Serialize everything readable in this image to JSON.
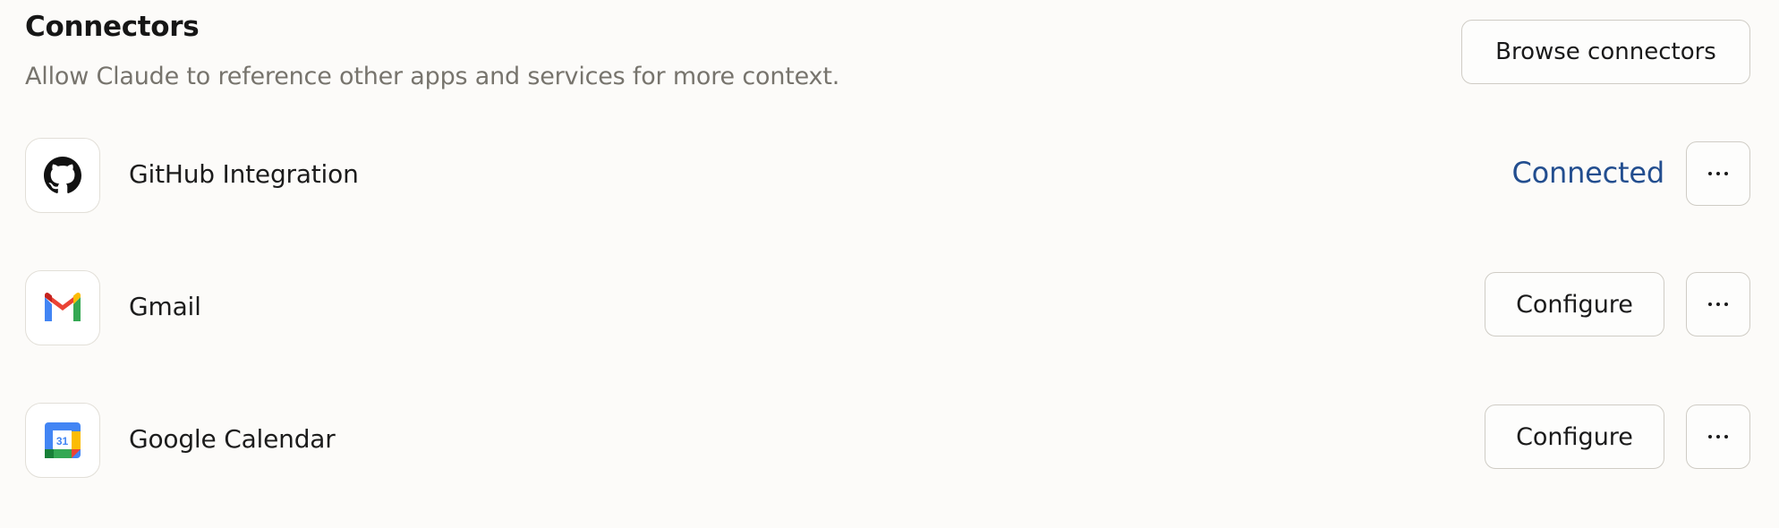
{
  "header": {
    "title": "Connectors",
    "subtitle": "Allow Claude to reference other apps and services for more context.",
    "browse_label": "Browse connectors"
  },
  "connectors": [
    {
      "name": "GitHub Integration",
      "icon": "github-icon",
      "status": "Connected",
      "more_icon": "more-horizontal-icon"
    },
    {
      "name": "Gmail",
      "icon": "gmail-icon",
      "action_label": "Configure",
      "more_icon": "more-horizontal-icon"
    },
    {
      "name": "Google Calendar",
      "icon": "google-calendar-icon",
      "icon_text": "31",
      "action_label": "Configure",
      "more_icon": "more-horizontal-icon"
    }
  ],
  "colors": {
    "background": "#fcfbf9",
    "connected_text": "#234e8f",
    "subtitle_text": "#77746d",
    "border": "#cfccc5"
  }
}
